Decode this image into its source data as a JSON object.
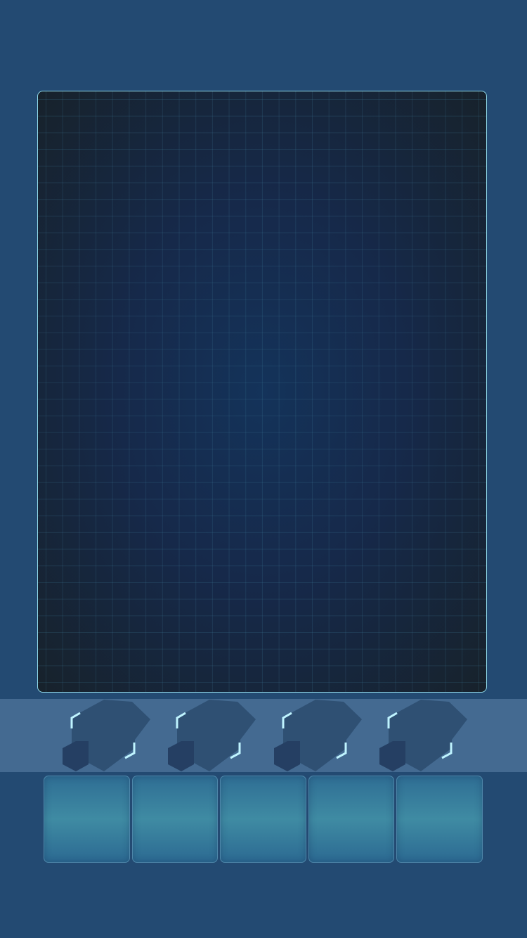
{
  "game": {
    "board": {
      "label": ""
    },
    "piece_slots": [
      {
        "icon": "hex-piece-icon"
      },
      {
        "icon": "hex-piece-icon"
      },
      {
        "icon": "hex-piece-icon"
      },
      {
        "icon": "hex-piece-icon"
      }
    ],
    "action_cells": [
      {
        "label": ""
      },
      {
        "label": ""
      },
      {
        "label": ""
      },
      {
        "label": ""
      },
      {
        "label": ""
      }
    ],
    "colors": {
      "background": "#234a72",
      "board_border": "#8fd8e8",
      "tray": "#446a91",
      "piece": "#2f5073",
      "piece_dark": "#253f63",
      "bracket": "#bff4ff",
      "cell": "#3f8ba3"
    }
  }
}
